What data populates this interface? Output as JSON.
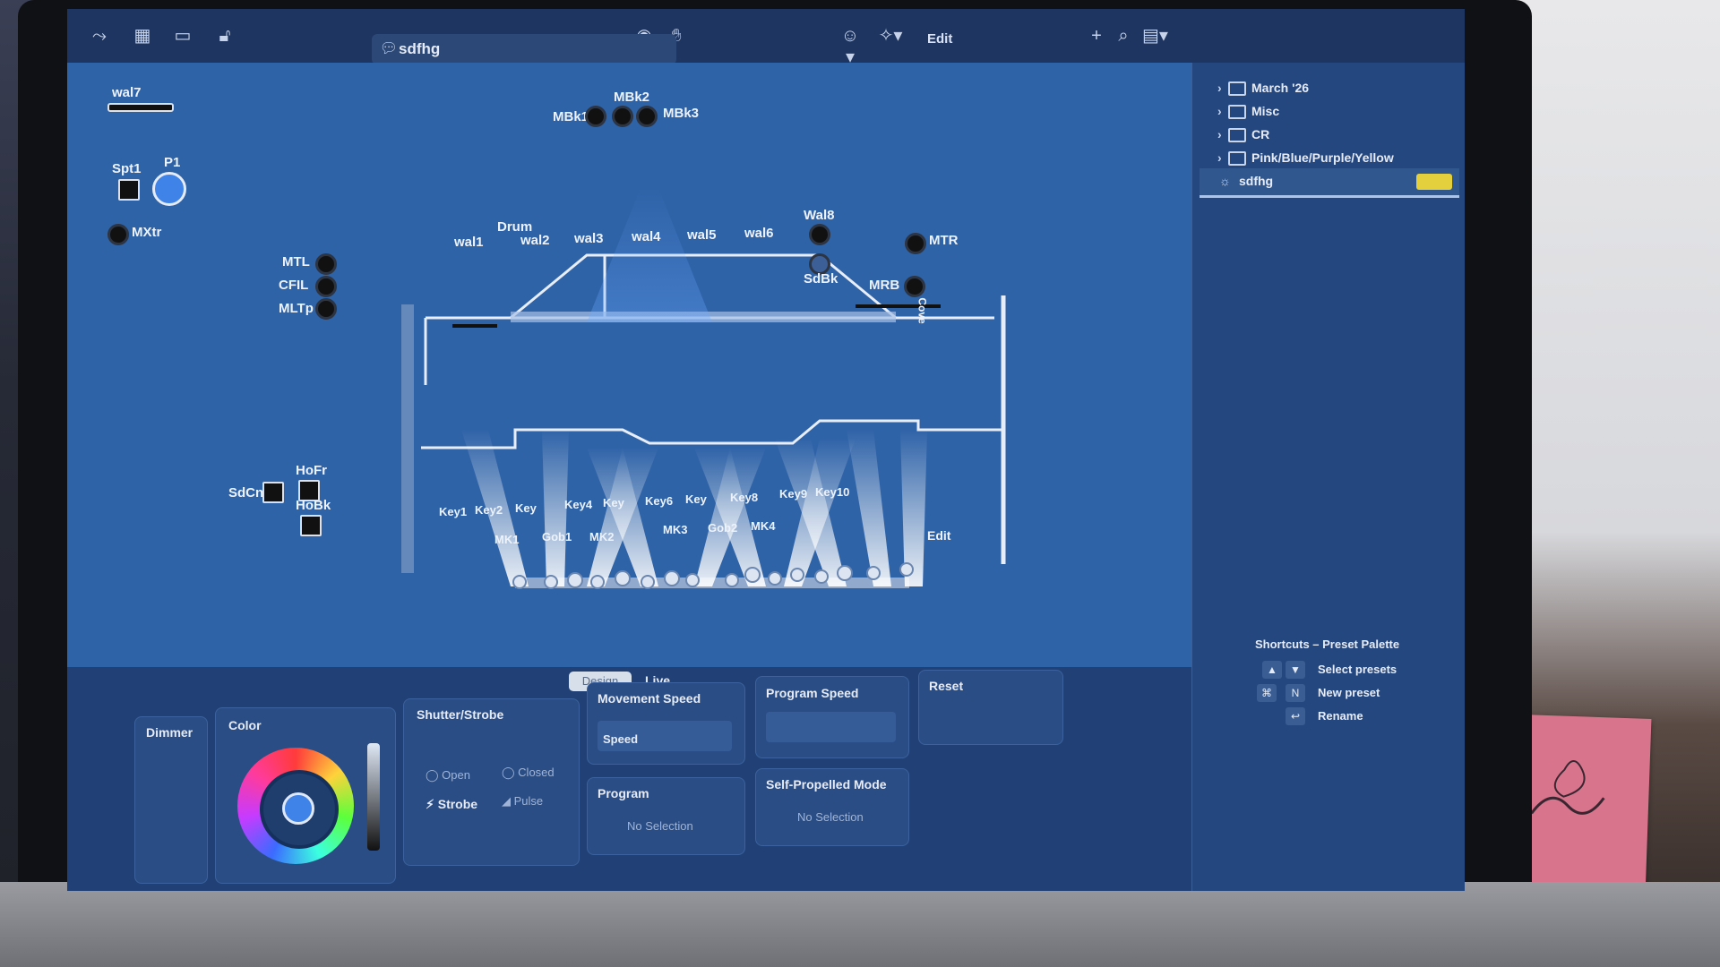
{
  "toolbar": {
    "preset_name": "sdfhg",
    "edit_label": "Edit"
  },
  "sidebar": {
    "folders": [
      "March '26",
      "Misc",
      "CR",
      "Pink/Blue/Purple/Yellow"
    ],
    "selected_preset": "sdfhg",
    "shortcuts_title": "Shortcuts – Preset Palette",
    "shortcuts": [
      {
        "keys": [
          "▲",
          "▼"
        ],
        "label": "Select presets"
      },
      {
        "keys": [
          "⌘",
          "N"
        ],
        "label": "New preset"
      },
      {
        "keys": [
          "↩"
        ],
        "label": "Rename"
      }
    ]
  },
  "stage": {
    "fixtures": {
      "wal7": "wal7",
      "spt1": "Spt1",
      "p1": "P1",
      "mxtr": "MXtr",
      "mbk1": "MBk1",
      "mbk2": "MBk2",
      "mbk3": "MBk3",
      "drum": "Drum",
      "wal1": "wal1",
      "wal2": "wal2",
      "wal3": "wal3",
      "wal4": "wal4",
      "wal5": "wal5",
      "wal6": "wal6",
      "wal8": "Wal8",
      "sdbk": "SdBk",
      "mtr": "MTR",
      "mrb": "MRB",
      "cove": "Cove",
      "mtl": "MTL",
      "cfil": "CFIL",
      "mltp": "MLTp",
      "hofr": "HoFr",
      "sdcn": "SdCn",
      "hobk": "HoBk",
      "key1": "Key1",
      "key2": "Key2",
      "key3": "Key",
      "key4": "Key4",
      "key5": "Key",
      "key6": "Key6",
      "key7": "Key",
      "key8": "Key8",
      "key9": "Key9",
      "key10": "Key10",
      "mk1": "MK1",
      "gob1": "Gob1",
      "mk2": "MK2",
      "mk3": "MK3",
      "gob2": "Gob2",
      "mk4": "MK4"
    },
    "edit_label": "Edit"
  },
  "mode_tabs": {
    "design": "Design",
    "live": "Live"
  },
  "controls": {
    "dimmer": "Dimmer",
    "color": "Color",
    "shutter": {
      "title": "Shutter/Strobe",
      "open": "Open",
      "closed": "Closed",
      "strobe": "Strobe",
      "pulse": "Pulse"
    },
    "movement_speed": {
      "title": "Movement Speed",
      "speed": "Speed"
    },
    "program_speed": {
      "title": "Program Speed"
    },
    "reset": {
      "title": "Reset"
    },
    "program": {
      "title": "Program",
      "value": "No Selection"
    },
    "self_propelled": {
      "title": "Self-Propelled Mode",
      "value": "No Selection"
    }
  },
  "colors": {
    "canvas": "#2f63a8",
    "sidebar": "#24477f",
    "selected_badge": "#e4cf3c",
    "fixture_active": "#3f83e8"
  }
}
